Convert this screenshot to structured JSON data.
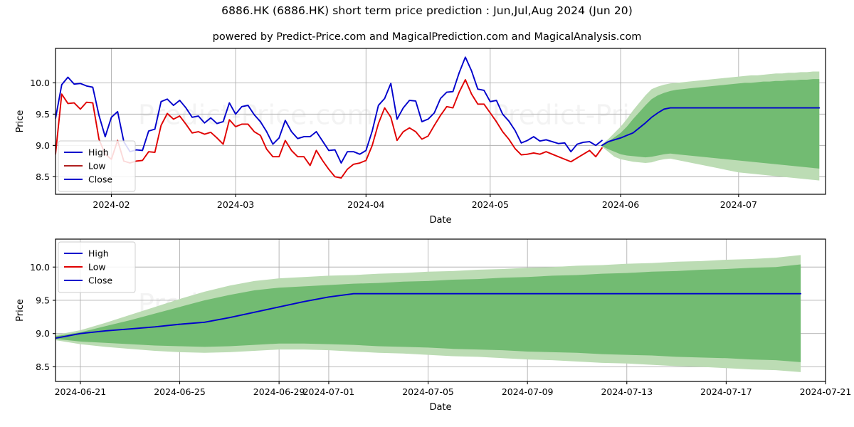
{
  "header": {
    "title": "6886.HK (6886.HK) short term price prediction : Jun,Jul,Aug 2024 (Jun 20)",
    "subtitle": "powered by Predict-Price.com and MagicalPrediction.com and MagicalAnalysis.com"
  },
  "watermark": {
    "text": "Predict-Price.com"
  },
  "colors": {
    "high": "#0000cc",
    "low": "#e00000",
    "low_dark": "#b02020",
    "close": "#0000cc",
    "band_outer": "#bcdcb4",
    "band_inner": "#72bb72",
    "grid": "#b0b0b0",
    "frame": "#000000"
  },
  "chart_data": [
    {
      "type": "line",
      "id": "top-panel",
      "title": "",
      "xlabel": "Date",
      "ylabel": "Price",
      "ylim": [
        8.22,
        10.55
      ],
      "yticks": [
        8.5,
        9.0,
        9.5,
        10.0
      ],
      "yticklabels": [
        "8.5",
        "9.0",
        "9.5",
        "10.0"
      ],
      "xlim": [
        0,
        124
      ],
      "xticks": [
        9,
        29,
        50,
        70,
        91,
        110
      ],
      "xticklabels": [
        "2024-02",
        "2024-03",
        "2024-04",
        "2024-05",
        "2024-06",
        "2024-07"
      ],
      "grid": true,
      "legend": {
        "position": "lower-left",
        "entries": [
          "High",
          "Low",
          "Close"
        ]
      },
      "series": [
        {
          "name": "High",
          "color": "#0000cc",
          "x_start": 0,
          "values": [
            9.43,
            9.97,
            10.09,
            9.98,
            9.99,
            9.95,
            9.93,
            9.48,
            9.14,
            9.45,
            9.54,
            9.06,
            8.9,
            8.93,
            8.92,
            9.23,
            9.26,
            9.7,
            9.74,
            9.64,
            9.72,
            9.6,
            9.45,
            9.47,
            9.36,
            9.44,
            9.35,
            9.38,
            9.68,
            9.5,
            9.62,
            9.64,
            9.49,
            9.38,
            9.22,
            9.02,
            9.12,
            9.4,
            9.22,
            9.11,
            9.14,
            9.14,
            9.22,
            9.07,
            8.92,
            8.93,
            8.72,
            8.9,
            8.9,
            8.86,
            8.92,
            9.23,
            9.64,
            9.75,
            9.99,
            9.42,
            9.6,
            9.72,
            9.71,
            9.38,
            9.42,
            9.52,
            9.75,
            9.85,
            9.86,
            10.16,
            10.41,
            10.19,
            9.9,
            9.88,
            9.7,
            9.72,
            9.5,
            9.39,
            9.24,
            9.04,
            9.08,
            9.14,
            9.07,
            9.09,
            9.06,
            9.03,
            9.04,
            8.9,
            9.02,
            9.05,
            9.06,
            9.0,
            9.08
          ]
        },
        {
          "name": "Low",
          "color": "#e00000",
          "x_start": 0,
          "values": [
            8.86,
            9.82,
            9.67,
            9.68,
            9.58,
            9.69,
            9.68,
            9.1,
            8.86,
            8.78,
            9.08,
            8.75,
            8.72,
            8.75,
            8.76,
            8.9,
            8.89,
            9.32,
            9.51,
            9.42,
            9.47,
            9.34,
            9.2,
            9.22,
            9.18,
            9.21,
            9.12,
            9.02,
            9.41,
            9.3,
            9.34,
            9.34,
            9.22,
            9.16,
            8.94,
            8.82,
            8.82,
            9.08,
            8.92,
            8.82,
            8.82,
            8.68,
            8.92,
            8.76,
            8.62,
            8.5,
            8.48,
            8.62,
            8.7,
            8.72,
            8.76,
            9.0,
            9.35,
            9.6,
            9.45,
            9.08,
            9.22,
            9.28,
            9.22,
            9.1,
            9.15,
            9.32,
            9.48,
            9.62,
            9.6,
            9.85,
            10.05,
            9.82,
            9.66,
            9.66,
            9.52,
            9.38,
            9.22,
            9.1,
            8.95,
            8.85,
            8.86,
            8.88,
            8.86,
            8.9,
            8.86,
            8.82,
            8.78,
            8.74,
            8.8,
            8.86,
            8.92,
            8.82,
            8.96
          ]
        },
        {
          "name": "Close",
          "color": "#0000cc",
          "x_start": 88,
          "values": [
            9.0,
            9.06,
            9.09,
            9.12,
            9.16,
            9.2,
            9.28,
            9.36,
            9.45,
            9.52,
            9.58,
            9.6,
            9.6,
            9.6,
            9.6,
            9.6,
            9.6,
            9.6,
            9.6,
            9.6,
            9.6,
            9.6,
            9.6,
            9.6,
            9.6,
            9.6,
            9.6,
            9.6,
            9.6,
            9.6,
            9.6,
            9.6,
            9.6,
            9.6,
            9.6,
            9.6
          ]
        }
      ],
      "bands": [
        {
          "name": "outer",
          "color": "#bcdcb4",
          "x_start": 88,
          "upper": [
            9.02,
            9.1,
            9.2,
            9.3,
            9.42,
            9.56,
            9.68,
            9.8,
            9.9,
            9.94,
            9.97,
            9.99,
            10.0,
            10.01,
            10.02,
            10.03,
            10.04,
            10.05,
            10.06,
            10.07,
            10.08,
            10.09,
            10.1,
            10.11,
            10.12,
            10.12,
            10.13,
            10.14,
            10.15,
            10.15,
            10.16,
            10.16,
            10.17,
            10.17,
            10.18,
            10.18
          ],
          "lower": [
            8.98,
            8.9,
            8.82,
            8.78,
            8.76,
            8.74,
            8.73,
            8.72,
            8.73,
            8.76,
            8.78,
            8.79,
            8.77,
            8.75,
            8.73,
            8.71,
            8.69,
            8.67,
            8.65,
            8.63,
            8.61,
            8.59,
            8.57,
            8.56,
            8.55,
            8.54,
            8.53,
            8.52,
            8.51,
            8.5,
            8.49,
            8.48,
            8.47,
            8.46,
            8.45,
            8.44
          ]
        },
        {
          "name": "inner",
          "color": "#72bb72",
          "x_start": 88,
          "upper": [
            9.01,
            9.06,
            9.13,
            9.2,
            9.3,
            9.42,
            9.53,
            9.64,
            9.74,
            9.8,
            9.84,
            9.87,
            9.89,
            9.9,
            9.91,
            9.92,
            9.93,
            9.94,
            9.95,
            9.96,
            9.97,
            9.98,
            9.99,
            10.0,
            10.0,
            10.01,
            10.02,
            10.02,
            10.03,
            10.03,
            10.04,
            10.04,
            10.05,
            10.05,
            10.06,
            10.06
          ],
          "lower": [
            8.99,
            8.94,
            8.9,
            8.86,
            8.84,
            8.83,
            8.82,
            8.81,
            8.82,
            8.84,
            8.86,
            8.87,
            8.86,
            8.85,
            8.84,
            8.83,
            8.82,
            8.81,
            8.8,
            8.79,
            8.78,
            8.77,
            8.76,
            8.75,
            8.74,
            8.73,
            8.72,
            8.71,
            8.7,
            8.69,
            8.68,
            8.67,
            8.66,
            8.65,
            8.64,
            8.63
          ]
        }
      ]
    },
    {
      "type": "line",
      "id": "bottom-panel",
      "title": "",
      "xlabel": "Date",
      "ylabel": "Price",
      "ylim": [
        8.28,
        10.42
      ],
      "yticks": [
        8.5,
        9.0,
        9.5,
        10.0
      ],
      "yticklabels": [
        "8.5",
        "9.0",
        "9.5",
        "10.0"
      ],
      "xlim": [
        0,
        31
      ],
      "xticks": [
        1,
        5,
        9,
        11,
        15,
        19,
        23,
        27,
        31
      ],
      "xticklabels": [
        "2024-06-21",
        "2024-06-25",
        "2024-06-29",
        "2024-07-01",
        "2024-07-05",
        "2024-07-09",
        "2024-07-13",
        "2024-07-17",
        "2024-07-21"
      ],
      "grid": true,
      "legend": {
        "position": "upper-left",
        "entries": [
          "High",
          "Low",
          "Close"
        ]
      },
      "series": [
        {
          "name": "Close",
          "color": "#0000cc",
          "x_start": 0,
          "values": [
            8.93,
            9.0,
            9.04,
            9.07,
            9.1,
            9.14,
            9.17,
            9.24,
            9.32,
            9.4,
            9.48,
            9.55,
            9.6,
            9.6,
            9.6,
            9.6,
            9.6,
            9.6,
            9.6,
            9.6,
            9.6,
            9.6,
            9.6,
            9.6,
            9.6,
            9.6,
            9.6,
            9.6,
            9.6,
            9.6,
            9.6
          ]
        }
      ],
      "bands": [
        {
          "name": "outer",
          "color": "#bcdcb4",
          "x_start": 0,
          "upper": [
            8.98,
            9.05,
            9.16,
            9.28,
            9.4,
            9.52,
            9.63,
            9.72,
            9.79,
            9.83,
            9.85,
            9.87,
            9.88,
            9.9,
            9.91,
            9.93,
            9.94,
            9.96,
            9.97,
            9.99,
            10.0,
            10.02,
            10.03,
            10.05,
            10.06,
            10.08,
            10.09,
            10.11,
            10.12,
            10.14,
            10.18
          ],
          "lower": [
            8.9,
            8.84,
            8.8,
            8.77,
            8.74,
            8.72,
            8.71,
            8.72,
            8.74,
            8.76,
            8.76,
            8.75,
            8.73,
            8.71,
            8.7,
            8.68,
            8.66,
            8.65,
            8.63,
            8.61,
            8.6,
            8.58,
            8.56,
            8.55,
            8.53,
            8.51,
            8.5,
            8.48,
            8.46,
            8.45,
            8.42
          ]
        },
        {
          "name": "inner",
          "color": "#72bb72",
          "x_start": 0,
          "upper": [
            8.96,
            9.02,
            9.11,
            9.2,
            9.3,
            9.4,
            9.5,
            9.58,
            9.65,
            9.69,
            9.71,
            9.73,
            9.75,
            9.76,
            9.78,
            9.79,
            9.81,
            9.82,
            9.84,
            9.85,
            9.87,
            9.88,
            9.9,
            9.91,
            9.93,
            9.94,
            9.96,
            9.97,
            9.99,
            10.0,
            10.04
          ],
          "lower": [
            8.92,
            8.88,
            8.86,
            8.84,
            8.82,
            8.81,
            8.8,
            8.81,
            8.83,
            8.85,
            8.85,
            8.84,
            8.83,
            8.81,
            8.8,
            8.79,
            8.77,
            8.76,
            8.75,
            8.73,
            8.72,
            8.71,
            8.69,
            8.68,
            8.67,
            8.65,
            8.64,
            8.63,
            8.61,
            8.6,
            8.57
          ]
        }
      ]
    }
  ]
}
